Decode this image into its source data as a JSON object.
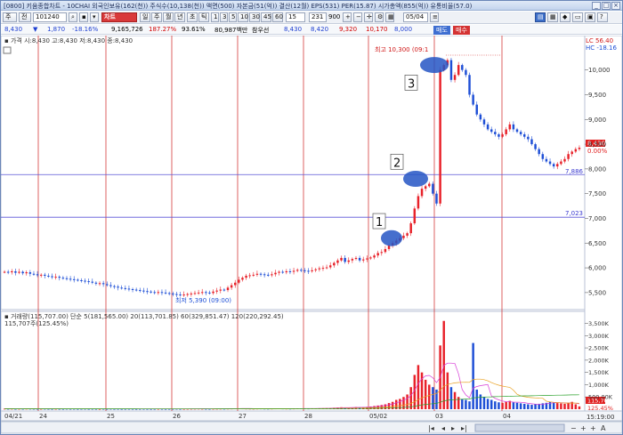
{
  "title_bar": {
    "text": "[0800] 키움종합차트 - 10CHAI 외국인보유(162(천)) 주식수(10,138(천)) 액면(500) 자본금(51(억)) 결산(12월) EPS(531) PER(15.87) 시가총액(855(억)) 유통비율(57.0)",
    "buttons": [
      "_",
      "□",
      "×"
    ]
  },
  "toolbar": {
    "type_label": "주",
    "market_label": "전",
    "code": "101240",
    "chart_btn": "차트",
    "period_buttons": [
      "일",
      "주",
      "월",
      "년",
      "초",
      "틱"
    ],
    "minute_buttons": [
      "1",
      "3",
      "5",
      "10",
      "30",
      "45",
      "60"
    ],
    "minute_value": "15",
    "count_value": "231",
    "count_total": "900",
    "date_value": "05/04"
  },
  "quote": {
    "price": "8,430",
    "change_arrow": "▼",
    "change": "1,870",
    "change_pct": "-18.16%",
    "volume": "9,165,726",
    "vol_ratio": "187.27%",
    "strength": "93.61%",
    "amount": "80,987백만",
    "label": "참우선",
    "v1": "8,430",
    "v2": "8,420",
    "v3": "9,320",
    "v4": "10,170",
    "v5": "8,000",
    "sell_label": "매도",
    "buy_label": "매수"
  },
  "price_panel": {
    "ohlc_text": "▪ 가격 시:8,430 고:8,430 저:8,430 종:8,430",
    "high_annot": "최고 10,300 (09:1",
    "low_annot": "최저 5,390 (09:00)",
    "lc_label": "LC 56.40",
    "hc_label": "HC -18.16",
    "line1_label": "7,886",
    "line2_label": "7,023",
    "current_price_tag": "8,430",
    "current_pct_tag": "0.00%",
    "callouts": [
      "1",
      "2",
      "3"
    ],
    "y_ticks": [
      "10,000",
      "9,500",
      "9,000",
      "8,500",
      "8,000",
      "7,500",
      "7,000",
      "6,500",
      "6,000",
      "5,500"
    ]
  },
  "volume_panel": {
    "legend": "▪ 거래량(115,707.00)   단순 5(181,565.00)   20(113,701.85)   60(329,851.47)   120(220,292.45)",
    "sub_label": "115,707주(125.45%)",
    "y_ticks": [
      "3,500K",
      "3,000K",
      "2,500K",
      "2,000K",
      "1,500K",
      "1,000K",
      "500.00K"
    ],
    "vol_tag": "115,707",
    "vol_pct_tag": "125.45%"
  },
  "x_axis": {
    "labels": [
      "04/21",
      "24",
      "25",
      "26",
      "27",
      "28",
      "05/02",
      "03",
      "04"
    ],
    "time_label": "15:19:00"
  },
  "colors": {
    "up": "#e8222a",
    "down": "#1e4fd6",
    "vline": "#d02020",
    "hline": "#5a55d8",
    "callout": "#2455c4"
  },
  "chart_data": {
    "type": "candlestick",
    "ylim": [
      5300,
      10300
    ],
    "h_lines": [
      7886,
      7023
    ],
    "high": 10300,
    "low": 5390,
    "closes": [
      5920,
      5910,
      5930,
      5900,
      5920,
      5890,
      5910,
      5880,
      5870,
      5850,
      5860,
      5840,
      5830,
      5810,
      5820,
      5800,
      5790,
      5780,
      5770,
      5760,
      5750,
      5740,
      5730,
      5720,
      5700,
      5680,
      5690,
      5670,
      5650,
      5630,
      5620,
      5600,
      5590,
      5580,
      5570,
      5560,
      5550,
      5540,
      5530,
      5520,
      5510,
      5500,
      5510,
      5500,
      5490,
      5480,
      5470,
      5460,
      5450,
      5460,
      5470,
      5480,
      5490,
      5500,
      5510,
      5500,
      5490,
      5520,
      5540,
      5560,
      5550,
      5600,
      5650,
      5700,
      5760,
      5800,
      5840,
      5850,
      5860,
      5880,
      5870,
      5860,
      5850,
      5870,
      5900,
      5920,
      5910,
      5930,
      5920,
      5940,
      5960,
      5950,
      5940,
      5930,
      5950,
      5970,
      5990,
      6000,
      6010,
      6050,
      6100,
      6150,
      6200,
      6120,
      6150,
      6180,
      6200,
      6150,
      6170,
      6190,
      6210,
      6250,
      6300,
      6320,
      6380,
      6450,
      6500,
      6550,
      6600,
      6650,
      6700,
      6900,
      7200,
      7450,
      7600,
      7650,
      7700,
      7500,
      7300,
      10000,
      10100,
      10200,
      9800,
      9900,
      10100,
      10000,
      9900,
      9500,
      9300,
      9100,
      9000,
      8900,
      8800,
      8750,
      8700,
      8650,
      8700,
      8800,
      8900,
      8800,
      8750,
      8700,
      8650,
      8600,
      8500,
      8400,
      8300,
      8200,
      8150,
      8100,
      8050,
      8100,
      8150,
      8200,
      8300,
      8350,
      8400,
      8430
    ],
    "volumes": [
      20,
      15,
      18,
      12,
      16,
      14,
      20,
      18,
      15,
      12,
      14,
      16,
      12,
      10,
      14,
      12,
      10,
      15,
      12,
      14,
      10,
      12,
      14,
      10,
      12,
      10,
      8,
      12,
      10,
      14,
      10,
      12,
      8,
      10,
      12,
      10,
      8,
      10,
      12,
      10,
      8,
      10,
      12,
      10,
      8,
      10,
      12,
      14,
      10,
      12,
      14,
      16,
      18,
      20,
      16,
      14,
      12,
      16,
      18,
      20,
      18,
      22,
      25,
      30,
      35,
      28,
      24,
      22,
      20,
      24,
      26,
      22,
      20,
      24,
      28,
      30,
      26,
      24,
      22,
      26,
      30,
      32,
      28,
      26,
      30,
      34,
      38,
      40,
      44,
      50,
      60,
      70,
      80,
      60,
      65,
      70,
      90,
      80,
      85,
      95,
      110,
      130,
      150,
      170,
      200,
      250,
      300,
      380,
      420,
      500,
      600,
      900,
      1400,
      1800,
      1500,
      1200,
      1000,
      900,
      800,
      2600,
      3600,
      1500,
      900,
      700,
      500,
      420,
      380,
      320,
      2700,
      800,
      600,
      500,
      420,
      380,
      320,
      280,
      260,
      300,
      340,
      280,
      260,
      240,
      220,
      200,
      180,
      200,
      220,
      240,
      260,
      300,
      280,
      250,
      240,
      220,
      260,
      300,
      200,
      115
    ],
    "vol_ylim": [
      0,
      3700
    ]
  }
}
